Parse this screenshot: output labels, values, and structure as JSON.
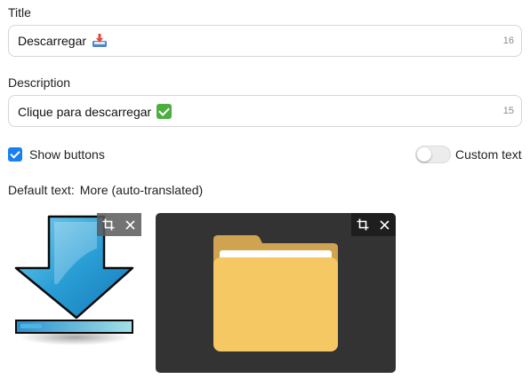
{
  "title_field": {
    "label": "Title",
    "value": "Descarregar",
    "emoji_icon": "inbox-tray-emoji",
    "counter": "16"
  },
  "description_field": {
    "label": "Description",
    "value": "Clique para descarregar",
    "emoji_icon": "check-mark-button-emoji",
    "counter": "15"
  },
  "options": {
    "show_buttons_label": "Show buttons",
    "show_buttons_checked": true,
    "custom_text_label": "Custom text",
    "custom_text_enabled": false
  },
  "default_text": {
    "label": "Default text:",
    "value": "More (auto-translated)"
  },
  "images": [
    {
      "icon": "download-arrow-icon",
      "tools": [
        "crop-icon",
        "close-icon"
      ]
    },
    {
      "icon": "folder-icon",
      "tools": [
        "crop-icon",
        "close-icon"
      ]
    }
  ],
  "colors": {
    "accent": "#1a7ff0",
    "thumb_dark_bg": "#333333",
    "folder": "#f6c863"
  }
}
